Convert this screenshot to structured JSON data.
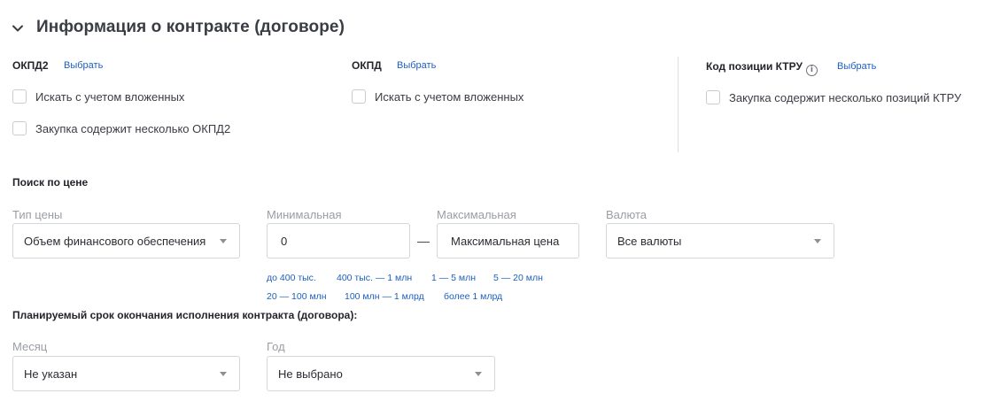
{
  "section": {
    "title": "Информация о контракте (договоре)"
  },
  "okpd2": {
    "label": "ОКПД2",
    "choose": "Выбрать",
    "checkbox_nested": "Искать с учетом вложенных",
    "checkbox_multiple": "Закупка содержит несколько ОКПД2"
  },
  "okpd": {
    "label": "ОКПД",
    "choose": "Выбрать",
    "checkbox_nested": "Искать с учетом вложенных"
  },
  "ktru": {
    "label": "Код позиции КТРУ",
    "info_icon": "i",
    "choose": "Выбрать",
    "checkbox_multiple": "Закупка содержит несколько позиций КТРУ"
  },
  "price": {
    "title": "Поиск по цене",
    "type_label": "Тип цены",
    "type_value": "Объем финансового обеспечения",
    "min_label": "Минимальная",
    "min_value": "0",
    "dash": "—",
    "max_label": "Максимальная",
    "max_placeholder": "Максимальная цена",
    "currency_label": "Валюта",
    "currency_value": "Все валюты",
    "presets": [
      "до 400 тыс.",
      "400 тыс. — 1 млн",
      "1 — 5 млн",
      "5 — 20 млн",
      "20 — 100 млн",
      "100 млн — 1 млрд",
      "более 1 млрд"
    ]
  },
  "deadline": {
    "title": "Планируемый срок окончания исполнения контракта (договора):",
    "month_label": "Месяц",
    "month_value": "Не указан",
    "year_label": "Год",
    "year_value": "Не выбрано"
  },
  "colors": {
    "link": "#1d5fbf",
    "border": "#d3d6db",
    "muted": "#9a9da4"
  },
  "icons": {
    "collapse": "chevron-down-icon",
    "info": "info-icon",
    "dropdown": "caret-down-icon"
  }
}
